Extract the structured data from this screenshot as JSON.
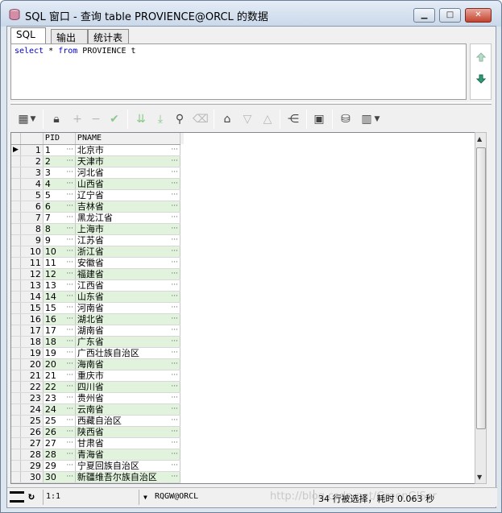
{
  "window": {
    "title": "SQL 窗口 - 查询 table PROVIENCE@ORCL 的数据"
  },
  "tabs": [
    "SQL",
    "输出",
    "统计表"
  ],
  "editor": {
    "kw1": "select",
    "star": " * ",
    "kw2": "from",
    "rest": " PROVIENCE t"
  },
  "grid": {
    "columns": [
      "PID",
      "PNAME"
    ],
    "rows": [
      {
        "num": "1",
        "pid": "1",
        "name": "北京市"
      },
      {
        "num": "2",
        "pid": "2",
        "name": "天津市"
      },
      {
        "num": "3",
        "pid": "3",
        "name": "河北省"
      },
      {
        "num": "4",
        "pid": "4",
        "name": "山西省"
      },
      {
        "num": "5",
        "pid": "5",
        "name": "辽宁省"
      },
      {
        "num": "6",
        "pid": "6",
        "name": "吉林省"
      },
      {
        "num": "7",
        "pid": "7",
        "name": "黑龙江省"
      },
      {
        "num": "8",
        "pid": "8",
        "name": "上海市"
      },
      {
        "num": "9",
        "pid": "9",
        "name": "江苏省"
      },
      {
        "num": "10",
        "pid": "10",
        "name": "浙江省"
      },
      {
        "num": "11",
        "pid": "11",
        "name": "安徽省"
      },
      {
        "num": "12",
        "pid": "12",
        "name": "福建省"
      },
      {
        "num": "13",
        "pid": "13",
        "name": "江西省"
      },
      {
        "num": "14",
        "pid": "14",
        "name": "山东省"
      },
      {
        "num": "15",
        "pid": "15",
        "name": "河南省"
      },
      {
        "num": "16",
        "pid": "16",
        "name": "湖北省"
      },
      {
        "num": "17",
        "pid": "17",
        "name": "湖南省"
      },
      {
        "num": "18",
        "pid": "18",
        "name": "广东省"
      },
      {
        "num": "19",
        "pid": "19",
        "name": "广西壮族自治区"
      },
      {
        "num": "20",
        "pid": "20",
        "name": "海南省"
      },
      {
        "num": "21",
        "pid": "21",
        "name": "重庆市"
      },
      {
        "num": "22",
        "pid": "22",
        "name": "四川省"
      },
      {
        "num": "23",
        "pid": "23",
        "name": "贵州省"
      },
      {
        "num": "24",
        "pid": "24",
        "name": "云南省"
      },
      {
        "num": "25",
        "pid": "25",
        "name": "西藏自治区"
      },
      {
        "num": "26",
        "pid": "26",
        "name": "陕西省"
      },
      {
        "num": "27",
        "pid": "27",
        "name": "甘肃省"
      },
      {
        "num": "28",
        "pid": "28",
        "name": "青海省"
      },
      {
        "num": "29",
        "pid": "29",
        "name": "宁夏回族自治区"
      },
      {
        "num": "30",
        "pid": "30",
        "name": "新疆维吾尔族自治区"
      }
    ]
  },
  "status": {
    "position": "1:1",
    "connection": "RQGW@ORCL",
    "message": "34 行被选择，耗时 0.063 秒",
    "watermark": "http://blog.csdn.net/GreenGISer"
  },
  "colors": {
    "grid_alt_row": "#e1f3dc",
    "keyword": "#0000c8"
  }
}
